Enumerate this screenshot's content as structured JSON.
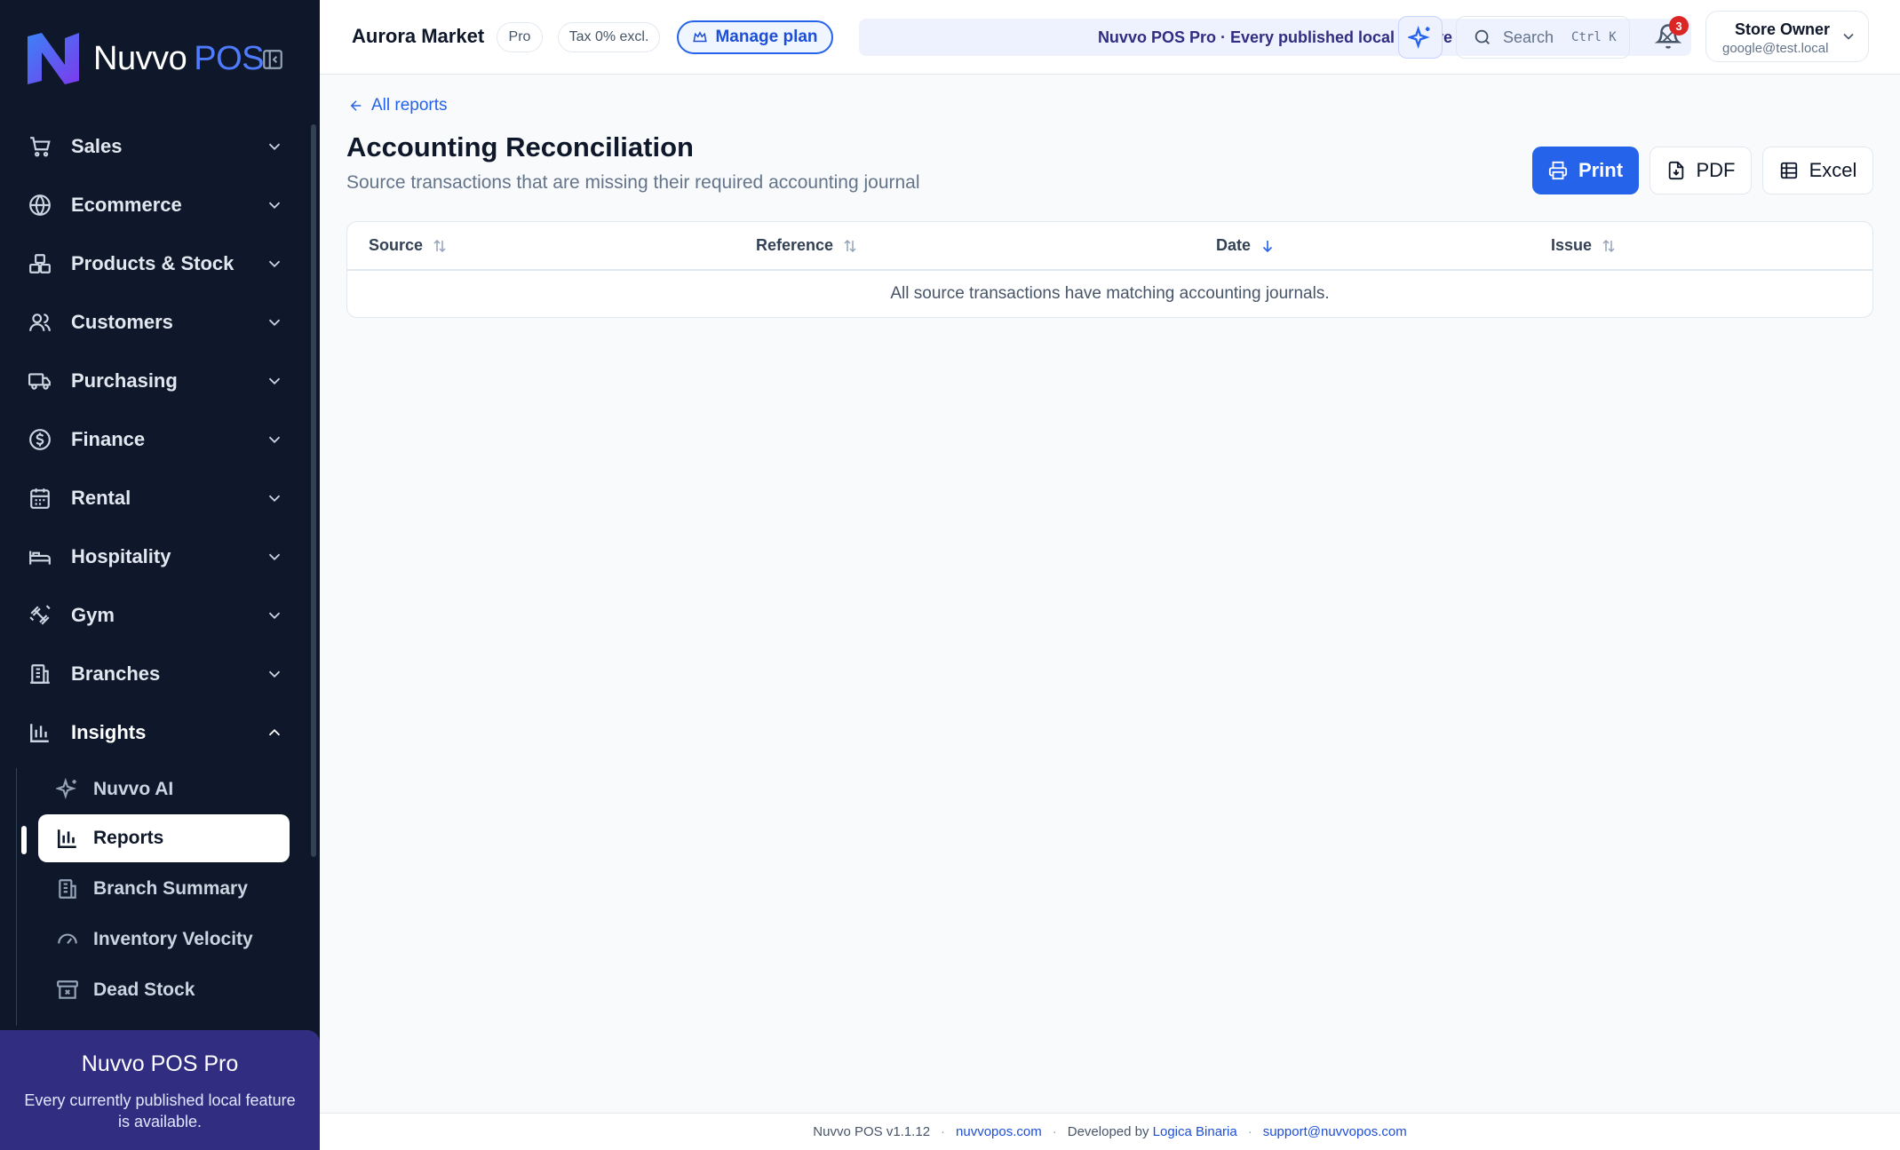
{
  "brand": {
    "name_main": "Nuvvo",
    "name_suffix": "POS"
  },
  "sidebar": {
    "items": [
      {
        "label": "Sales",
        "icon": "cart-icon"
      },
      {
        "label": "Ecommerce",
        "icon": "globe-icon"
      },
      {
        "label": "Products & Stock",
        "icon": "boxes-icon"
      },
      {
        "label": "Customers",
        "icon": "users-icon"
      },
      {
        "label": "Purchasing",
        "icon": "truck-icon"
      },
      {
        "label": "Finance",
        "icon": "dollar-icon"
      },
      {
        "label": "Rental",
        "icon": "calendar-icon"
      },
      {
        "label": "Hospitality",
        "icon": "bed-icon"
      },
      {
        "label": "Gym",
        "icon": "dumbbell-icon"
      },
      {
        "label": "Branches",
        "icon": "building-icon"
      },
      {
        "label": "Insights",
        "icon": "bar-chart-icon"
      }
    ],
    "sub_items": [
      {
        "label": "Nuvvo AI",
        "icon": "sparkles-icon"
      },
      {
        "label": "Reports",
        "icon": "bar-chart-icon"
      },
      {
        "label": "Branch Summary",
        "icon": "building-icon"
      },
      {
        "label": "Inventory Velocity",
        "icon": "gauge-icon"
      },
      {
        "label": "Dead Stock",
        "icon": "archive-x-icon"
      }
    ],
    "active_sub": "Reports",
    "pro_card": {
      "title": "Nuvvo POS Pro",
      "desc": "Every currently published local feature is available."
    }
  },
  "topbar": {
    "store_name": "Aurora Market",
    "plan_badge": "Pro",
    "tax_badge": "Tax 0% excl.",
    "manage_label": "Manage plan",
    "banner_text": "Nuvvo POS Pro · Every published local feature",
    "search_placeholder": "Search",
    "search_shortcut": "Ctrl K",
    "notification_count": "3",
    "user_name": "Store Owner",
    "user_email": "google@test.local"
  },
  "main": {
    "back_label": "All reports",
    "title": "Accounting Reconciliation",
    "subtitle": "Source transactions that are missing their required accounting journal",
    "buttons": {
      "print": "Print",
      "pdf": "PDF",
      "excel": "Excel"
    },
    "table": {
      "columns": [
        "Source",
        "Reference",
        "Date",
        "Issue"
      ],
      "sorted_column": "Date",
      "empty_message": "All source transactions have matching accounting journals."
    }
  },
  "footer": {
    "version": "Nuvvo POS v1.1.12",
    "site": "nuvvopos.com",
    "dev_prefix": "Developed by",
    "developer": "Logica Binaria",
    "support": "support@nuvvopos.com",
    "separator": "·"
  },
  "colors": {
    "sidebar_bg": "#0f172a",
    "accent": "#2563eb",
    "pro_card": "#312e81",
    "badge": "#dc2626"
  }
}
